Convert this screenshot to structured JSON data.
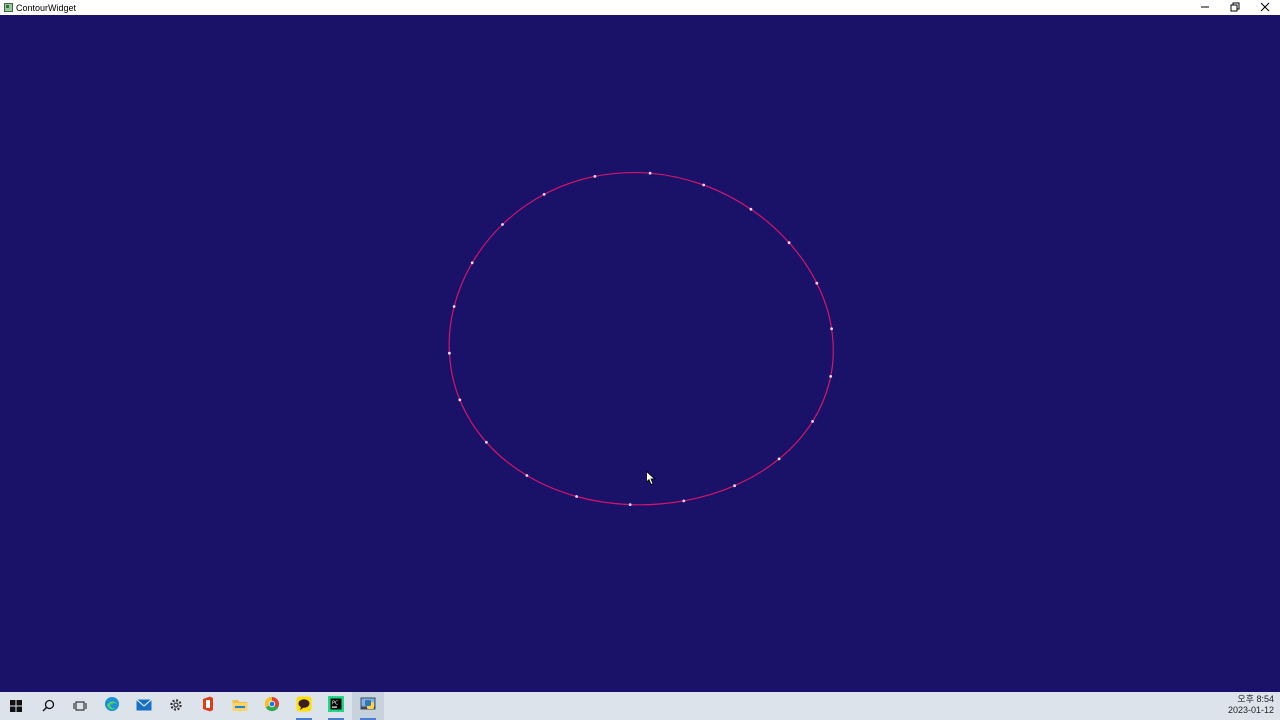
{
  "window": {
    "title": "ContourWidget",
    "controls": {
      "minimize": "minimize-icon",
      "restore": "restore-icon",
      "close": "close-icon"
    }
  },
  "canvas": {
    "background": "#1a1169",
    "contour": {
      "stroke_color": "#d0166a",
      "point_color": "#f0d6ff",
      "point_count": 22
    }
  },
  "taskbar": {
    "icons": [
      "windows-start-icon",
      "search-icon",
      "task-view-icon",
      "edge-icon",
      "mail-icon",
      "settings-icon",
      "office-icon",
      "file-explorer-icon",
      "chrome-icon",
      "kakaotalk-icon",
      "pycharm-icon",
      "python-app-icon"
    ],
    "clock": {
      "time": "오후 8:54",
      "date": "2023-01-12"
    }
  }
}
